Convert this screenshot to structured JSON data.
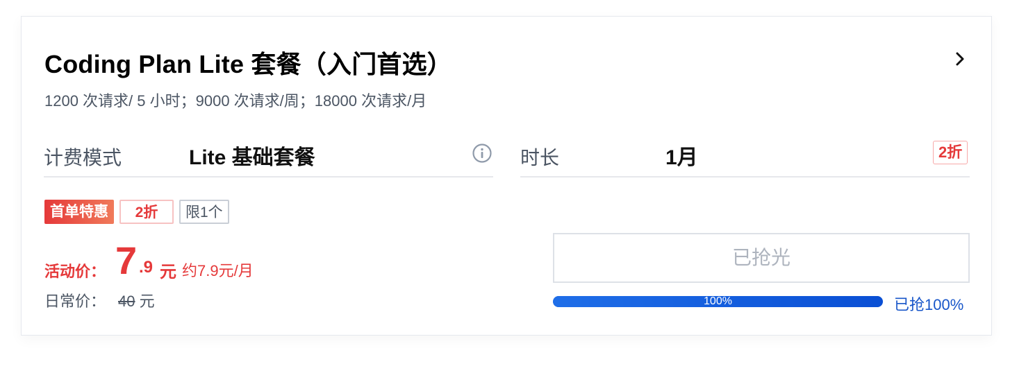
{
  "plan": {
    "title": "Coding Plan Lite 套餐（入门首选）",
    "subtitle": "1200 次请求/ 5 小时；9000 次请求/周；18000 次请求/月"
  },
  "billing": {
    "label": "计费模式",
    "value": "Lite 基础套餐"
  },
  "duration": {
    "label": "时长",
    "value": "1月",
    "discount_tag": "2折"
  },
  "tags": {
    "first_order": "首单特惠",
    "discount": "2折",
    "limit": "限1个"
  },
  "price": {
    "label": "活动价：",
    "integer": "7",
    "decimal": ".9",
    "unit": "元",
    "per_month": "约7.9元/月"
  },
  "regular_price": {
    "label": "日常价：",
    "value": "40",
    "unit": "元"
  },
  "purchase": {
    "button_label": "已抢光",
    "progress_percent": 100,
    "progress_text": "100%",
    "progress_label": "已抢100%"
  },
  "colors": {
    "accent_red": "#e5393a",
    "accent_blue": "#1856c9"
  },
  "icons": {
    "chevron": "chevron-right-icon",
    "info": "info-circle-icon"
  }
}
